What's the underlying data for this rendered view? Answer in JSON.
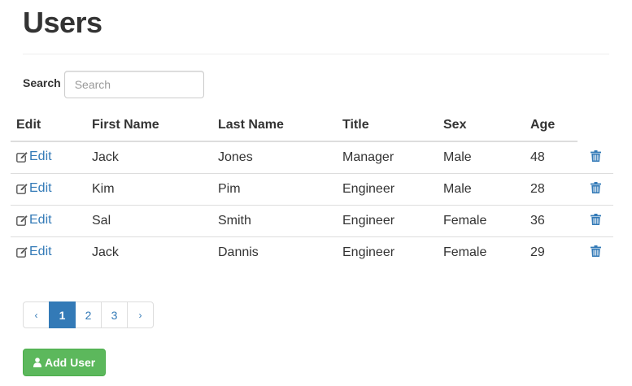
{
  "page": {
    "title": "Users"
  },
  "search": {
    "label": "Search",
    "placeholder": "Search",
    "value": ""
  },
  "table": {
    "headers": {
      "edit": "Edit",
      "first_name": "First Name",
      "last_name": "Last Name",
      "title": "Title",
      "sex": "Sex",
      "age": "Age"
    },
    "edit_label": "Edit",
    "rows": [
      {
        "first_name": "Jack",
        "last_name": "Jones",
        "title": "Manager",
        "sex": "Male",
        "age": "48"
      },
      {
        "first_name": "Kim",
        "last_name": "Pim",
        "title": "Engineer",
        "sex": "Male",
        "age": "28"
      },
      {
        "first_name": "Sal",
        "last_name": "Smith",
        "title": "Engineer",
        "sex": "Female",
        "age": "36"
      },
      {
        "first_name": "Jack",
        "last_name": "Dannis",
        "title": "Engineer",
        "sex": "Female",
        "age": "29"
      }
    ]
  },
  "pagination": {
    "prev": "‹",
    "pages": [
      "1",
      "2",
      "3"
    ],
    "active_page": "1",
    "next": "›"
  },
  "actions": {
    "add_user_label": "Add User"
  },
  "icons": {
    "edit": "edit-icon",
    "delete": "trash-icon",
    "add_user": "user-icon"
  },
  "colors": {
    "link": "#337ab7",
    "primary": "#337ab7",
    "success": "#5cb85c"
  }
}
